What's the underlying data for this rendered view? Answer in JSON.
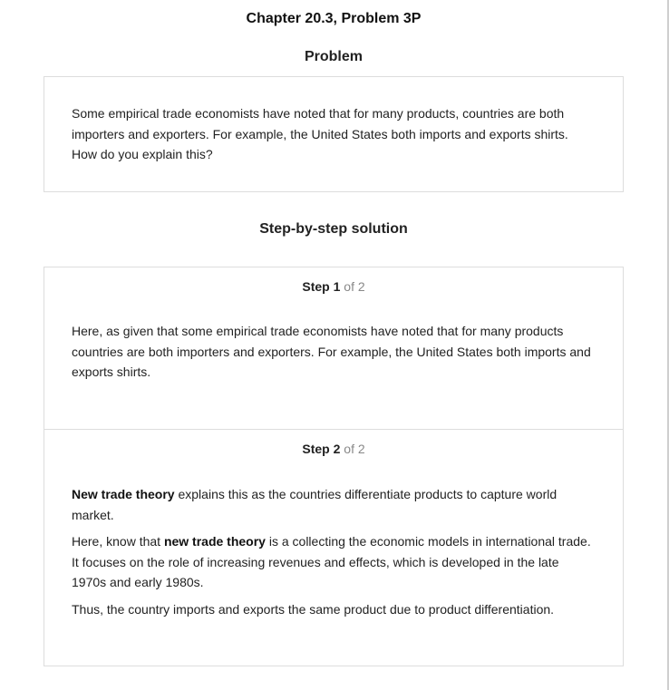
{
  "page": {
    "title": "Chapter 20.3, Problem 3P"
  },
  "problem": {
    "heading": "Problem",
    "text": "Some empirical trade economists have noted that for many products, countries are both importers and exporters. For example, the United States both imports and exports shirts. How do you explain this?"
  },
  "solution": {
    "heading": "Step-by-step solution",
    "steps": [
      {
        "label": "Step",
        "number": "1",
        "of_text": "of 2",
        "paragraphs": [
          {
            "text": "Here, as given that some empirical trade economists have noted that for many products countries are both importers and exporters. For example, the United States both imports and exports shirts."
          }
        ]
      },
      {
        "label": "Step",
        "number": "2",
        "of_text": "of 2",
        "paragraphs": [
          {
            "before": "",
            "bold": "New trade theory",
            "after": " explains this as the countries differentiate products to capture world market."
          },
          {
            "before": "Here, know that ",
            "bold": "new trade theory",
            "after": " is a collecting the economic models in international trade. It focuses on the role of increasing revenues and effects, which is developed in the late 1970s and early 1980s."
          },
          {
            "text": "Thus, the country imports and exports the same product due to product differentiation."
          }
        ]
      }
    ]
  }
}
